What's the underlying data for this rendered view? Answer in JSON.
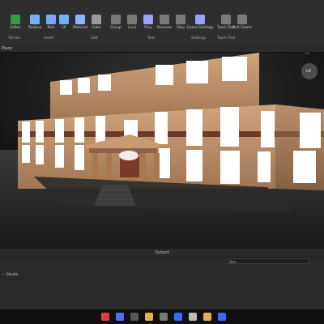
{
  "ribbon": {
    "tools": [
      {
        "label": "Editor",
        "color": "#2f9e44"
      },
      {
        "label": "Toolbox",
        "color": "#6fb3ff"
      },
      {
        "label": "Part",
        "color": "#7aa7ff"
      },
      {
        "label": "UI",
        "color": "#6fb3ff"
      },
      {
        "label": "Material",
        "color": "#8fb3ff"
      },
      {
        "label": "Color",
        "color": "#9a9a9a"
      },
      {
        "label": "Group",
        "color": "#7a7a7a"
      },
      {
        "label": "Lock",
        "color": "#7a7a7a"
      },
      {
        "label": "Anchor",
        "color": "#7a7a7a"
      },
      {
        "label": "Play",
        "color": "#9aa0ff"
      },
      {
        "label": "Resume",
        "color": "#7a7a7a"
      },
      {
        "label": "Stop",
        "color": "#7a7a7a"
      },
      {
        "label": "Game Settings",
        "color": "#9aa0ff"
      },
      {
        "label": "Team Test",
        "color": "#7a7a7a"
      },
      {
        "label": "Exit Game",
        "color": "#7a7a7a"
      }
    ],
    "groups": [
      "Terrain",
      "Insert",
      "Edit",
      "Test",
      "Settings",
      "Team Test"
    ]
  },
  "tabs": {
    "place": "Place"
  },
  "viewport": {
    "camera_label": "4D",
    "gizmo_label": "LK"
  },
  "output": {
    "title": "Output",
    "filter_placeholder": "Filter...",
    "log_line": "— Studio"
  },
  "taskbar": {
    "items": [
      "opera",
      "search",
      "files",
      "store",
      "shop",
      "mail",
      "chat",
      "folder",
      "roblox"
    ]
  },
  "colors": {
    "accent": "#0a6cff",
    "window_bg": "#1e1e1e"
  }
}
